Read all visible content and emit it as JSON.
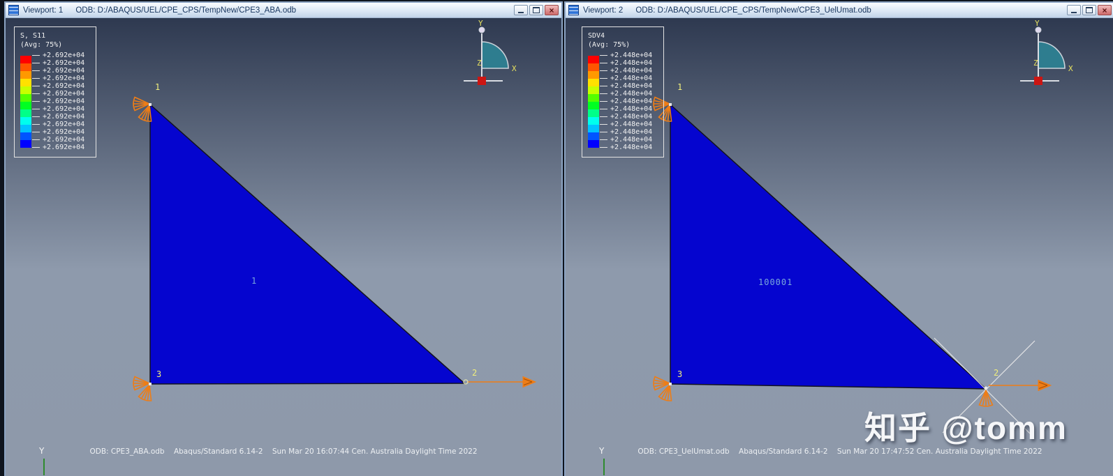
{
  "watermark": "知乎 @tomm",
  "colors": {
    "triangle_fill": "#0505cf",
    "triangle_edge": "#13131f",
    "bc_orange": "#ee7d16",
    "node_label": "#f0ee7c",
    "element_label": "#7aa8dc",
    "triad_disc": "#2e7d8f",
    "triad_base": "#cc1512",
    "contour_bands": [
      "#ff0000",
      "#ff5500",
      "#ff9900",
      "#ffe100",
      "#c8ff00",
      "#55ff00",
      "#00ff22",
      "#00ff88",
      "#00ffee",
      "#00c3ff",
      "#0055ff",
      "#0000ff"
    ]
  },
  "viewports": [
    {
      "title": "Viewport: 1",
      "odb": "ODB: D:/ABAQUS/UEL/CPE_CPS/TempNew/CPE3_ABA.odb",
      "legend": {
        "title": "S, S11",
        "subtitle": "(Avg: 75%)",
        "labels": [
          "+2.692e+04",
          "+2.692e+04",
          "+2.692e+04",
          "+2.692e+04",
          "+2.692e+04",
          "+2.692e+04",
          "+2.692e+04",
          "+2.692e+04",
          "+2.692e+04",
          "+2.692e+04",
          "+2.692e+04",
          "+2.692e+04",
          "+2.692e+04"
        ]
      },
      "triad": {
        "x": "X",
        "y": "Y",
        "z": "Z"
      },
      "element_label": "1",
      "nodes": {
        "n1": "1",
        "n2": "2",
        "n3": "3"
      },
      "axis_y": "Y",
      "status": "ODB: CPE3_ABA.odb    Abaqus/Standard 6.14-2    Sun Mar 20 16:07:44 Cen. Australia Daylight Time 2022"
    },
    {
      "title": "Viewport: 2",
      "odb": "ODB: D:/ABAQUS/UEL/CPE_CPS/TempNew/CPE3_UelUmat.odb",
      "legend": {
        "title": "SDV4",
        "subtitle": "(Avg: 75%)",
        "labels": [
          "+2.448e+04",
          "+2.448e+04",
          "+2.448e+04",
          "+2.448e+04",
          "+2.448e+04",
          "+2.448e+04",
          "+2.448e+04",
          "+2.448e+04",
          "+2.448e+04",
          "+2.448e+04",
          "+2.448e+04",
          "+2.448e+04",
          "+2.448e+04"
        ]
      },
      "triad": {
        "x": "X",
        "y": "Y",
        "z": "Z"
      },
      "element_label": "100001",
      "nodes": {
        "n1": "1",
        "n2": "2",
        "n3": "3"
      },
      "axis_y": "Y",
      "status": "ODB: CPE3_UelUmat.odb    Abaqus/Standard 6.14-2    Sun Mar 20 17:47:52 Cen. Australia Daylight Time 2022"
    }
  ]
}
